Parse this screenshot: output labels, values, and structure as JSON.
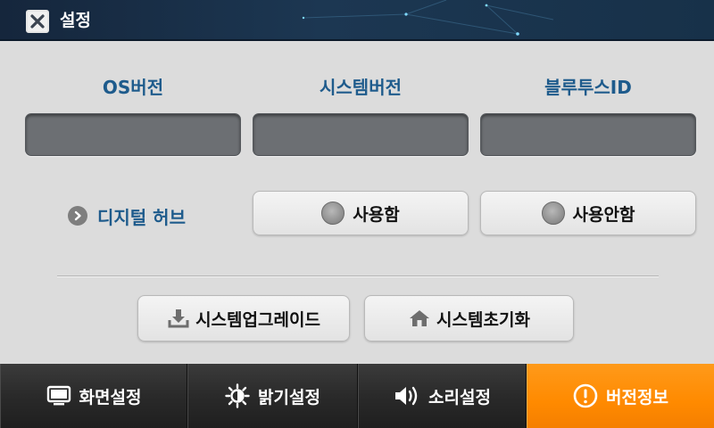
{
  "window": {
    "title": "설정",
    "close_icon": "close-x-icon"
  },
  "version_info": {
    "labels": [
      "OS버전",
      "시스템버전",
      "블루투스ID"
    ],
    "values": [
      "",
      "",
      ""
    ]
  },
  "digital_hub": {
    "label": "디지털 허브",
    "options": [
      "사용함",
      "사용안함"
    ],
    "selected": null
  },
  "actions": {
    "upgrade": {
      "label": "시스템업그레이드",
      "icon": "download-icon"
    },
    "reset": {
      "label": "시스템초기화",
      "icon": "home-icon"
    }
  },
  "bottom_nav": {
    "items": [
      {
        "label": "화면설정",
        "icon": "monitor-icon"
      },
      {
        "label": "밝기설정",
        "icon": "brightness-icon"
      },
      {
        "label": "소리설정",
        "icon": "speaker-icon"
      },
      {
        "label": "버전정보",
        "icon": "info-alert-icon"
      }
    ],
    "active_index": 3
  },
  "colors": {
    "accent": "#ff8a00",
    "label_blue": "#1e5b8c",
    "titlebar": "#1c3752"
  }
}
